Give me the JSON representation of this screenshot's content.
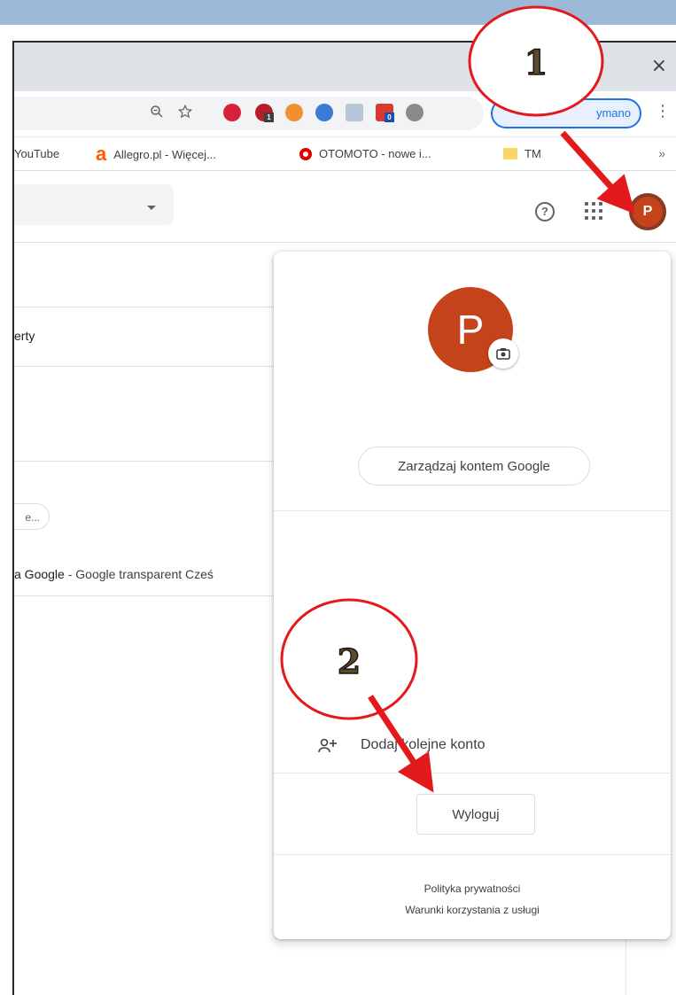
{
  "window": {
    "close_glyph": "×"
  },
  "toolbar": {
    "zoom_icon": "zoom-icon",
    "star_icon": "bookmark-star-icon",
    "extensions": [
      {
        "name": "extension-red-icon",
        "color": "#d6213b",
        "badge": ""
      },
      {
        "name": "extension-opera-icon",
        "color": "#b51d2a",
        "badge": "1"
      },
      {
        "name": "extension-orange-icon",
        "color": "#f0902e",
        "badge": ""
      },
      {
        "name": "extension-blue-icon",
        "color": "#3b7bd8",
        "badge": ""
      },
      {
        "name": "extension-gray-icon",
        "color": "#9aa0a6",
        "badge": ""
      },
      {
        "name": "extension-red-square-icon",
        "color": "#d93a2f",
        "badge": "0"
      },
      {
        "name": "extension-film-icon",
        "color": "#6b6b6b",
        "badge": ""
      }
    ],
    "profile_pill_text": "ymano",
    "menu_glyph": "⋮"
  },
  "bookmarks": {
    "items": [
      {
        "label": "YouTube"
      },
      {
        "label": "Allegro.pl - Więcej..."
      },
      {
        "label": "OTOMOTO - nowe i..."
      },
      {
        "label": "TM"
      }
    ],
    "more": "»"
  },
  "app_header": {
    "help_glyph": "?",
    "avatar_letter": "P"
  },
  "page": {
    "card_text": "erty",
    "chip_text": "e...",
    "result_prefix": "a Google",
    "result_rest": " - Google transparent Cześ"
  },
  "account_popup": {
    "avatar_letter": "P",
    "manage_button": "Zarządzaj kontem Google",
    "add_account": "Dodaj kolejne konto",
    "logout_button": "Wyloguj",
    "privacy": "Polityka prywatności",
    "terms": "Warunki korzystania z usługi"
  },
  "annotations": {
    "callout_1": "1",
    "callout_2": "2",
    "arrow_color": "#e3191b"
  }
}
